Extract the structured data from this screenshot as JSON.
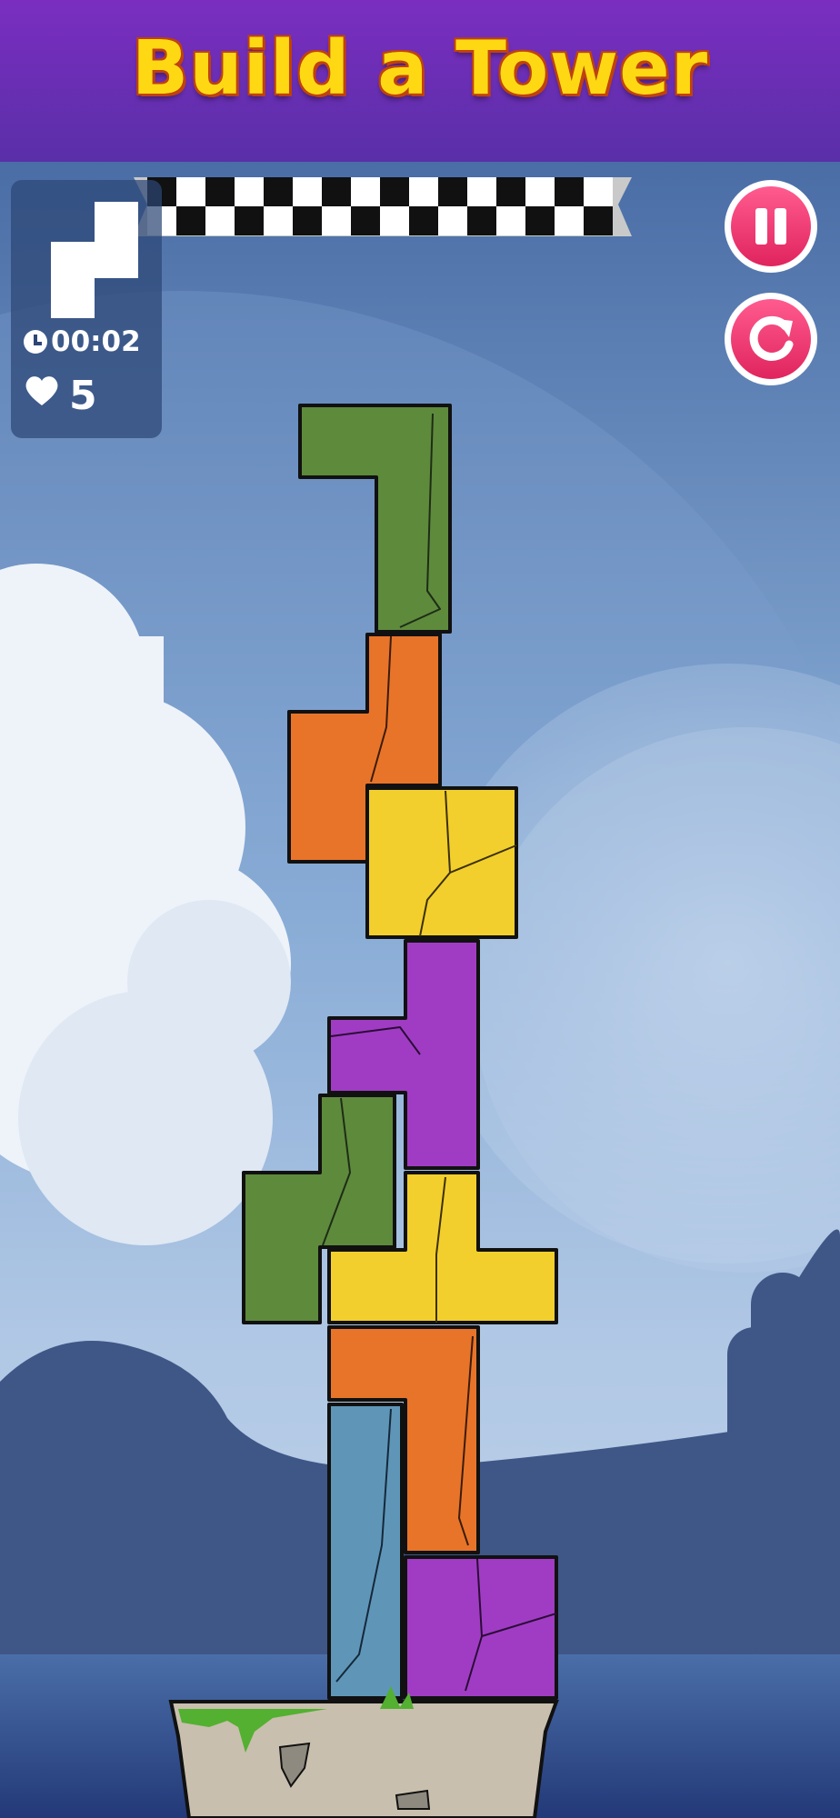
{
  "game": {
    "title": "Build a Tower"
  },
  "hud": {
    "timer": "00:02",
    "lives": "5",
    "next_piece_color": "#ffffff"
  },
  "buttons": {
    "pause": {
      "icon": "pause-icon"
    },
    "restart": {
      "icon": "restart-icon"
    }
  },
  "colors": {
    "header": "#6a2fb8",
    "title": "#ffd814",
    "green": "#5e8a3c",
    "orange": "#e8742a",
    "yellow": "#f2cf2c",
    "purple": "#a03cc4",
    "blue": "#5f96b8",
    "button": "#e8306a"
  }
}
